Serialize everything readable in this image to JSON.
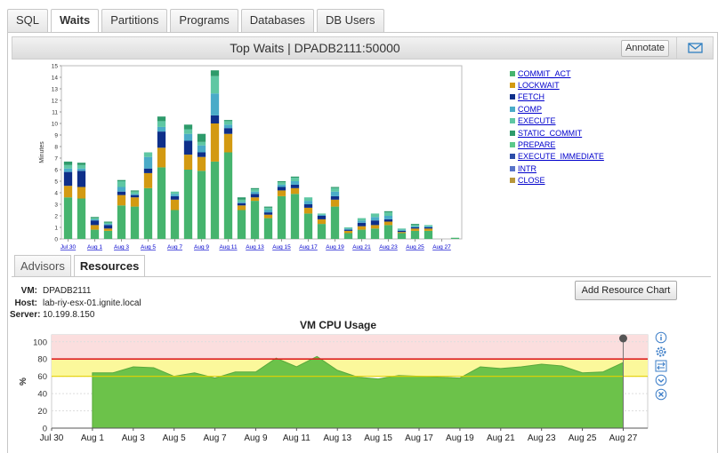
{
  "tabs": [
    "SQL",
    "Waits",
    "Partitions",
    "Programs",
    "Databases",
    "DB Users"
  ],
  "header": {
    "title": "Top Waits  |  DPADB2111:50000",
    "annotate_label": "Annotate",
    "mail_icon": "envelope-icon"
  },
  "legend": [
    "COMMIT_ACT",
    "LOCKWAIT",
    "FETCH",
    "COMP",
    "EXECUTE",
    "STATIC_COMMIT",
    "PREPARE",
    "EXECUTE_IMMEDIATE",
    "INTR",
    "CLOSE"
  ],
  "colors": {
    "COMMIT_ACT": "#46b46e",
    "LOCKWAIT": "#d39a12",
    "FETCH": "#0e2f8a",
    "COMP": "#4aabc8",
    "EXECUTE": "#5fc7a3",
    "STATIC_COMMIT": "#2e9b6b",
    "PREPARE": "#5bc98a",
    "EXECUTE_IMMEDIATE": "#2c4da8",
    "INTR": "#5873c8",
    "CLOSE": "#b8973a"
  },
  "subtabs": [
    "Advisors",
    "Resources"
  ],
  "resources": {
    "vm_key": "VM:",
    "vm": "DPADB2111",
    "host_key": "Host:",
    "host": "lab-riy-esx-01.ignite.local",
    "server_key": "Server:",
    "server": "10.199.8.150",
    "add_button": "Add Resource Chart",
    "side_icons": [
      "info-icon",
      "settings-icon",
      "swap-icon",
      "chevron-down-icon",
      "close-icon"
    ]
  },
  "chart_data": [
    {
      "type": "bar",
      "stacked": true,
      "ylabel": "Minutes",
      "ylim": [
        0,
        15
      ],
      "yticks": [
        0,
        1,
        2,
        3,
        4,
        5,
        6,
        7,
        8,
        9,
        10,
        11,
        12,
        13,
        14,
        15
      ],
      "xtick_labels": [
        "Jul 30",
        "Aug 1",
        "Aug 3",
        "Aug 5",
        "Aug 7",
        "Aug 9",
        "Aug 11",
        "Aug 13",
        "Aug 15",
        "Aug 17",
        "Aug 19",
        "Aug 21",
        "Aug 23",
        "Aug 25",
        "Aug 27"
      ],
      "bars_per_tick": 2,
      "series": [
        {
          "name": "COMMIT_ACT",
          "values": [
            3.6,
            3.5,
            0.8,
            0.7,
            2.9,
            2.8,
            4.4,
            6.2,
            2.5,
            6.0,
            5.9,
            6.7,
            7.5,
            2.5,
            3.3,
            1.8,
            3.7,
            3.9,
            2.2,
            1.3,
            2.8,
            0.5,
            0.8,
            0.9,
            1.2,
            0.5,
            0.7,
            0.7,
            0,
            0.1
          ]
        },
        {
          "name": "LOCKWAIT",
          "values": [
            1.0,
            1.0,
            0.4,
            0.2,
            0.9,
            0.8,
            1.3,
            1.7,
            0.9,
            1.3,
            1.2,
            3.3,
            1.6,
            0.4,
            0.3,
            0.3,
            0.5,
            0.5,
            0.5,
            0.4,
            0.6,
            0.2,
            0.3,
            0.3,
            0.3,
            0.1,
            0.2,
            0.2,
            0,
            0
          ]
        },
        {
          "name": "FETCH",
          "values": [
            1.2,
            1.4,
            0.4,
            0.3,
            0.3,
            0.2,
            0.4,
            1.4,
            0.3,
            1.2,
            0.4,
            0.7,
            0.5,
            0.2,
            0.3,
            0.2,
            0.3,
            0.3,
            0.3,
            0.3,
            0.3,
            0.1,
            0.3,
            0.4,
            0.2,
            0.1,
            0.1,
            0.1,
            0,
            0
          ]
        },
        {
          "name": "COMP",
          "values": [
            0.3,
            0.2,
            0.1,
            0.1,
            0.4,
            0.1,
            1.0,
            0.4,
            0.2,
            0.6,
            0.6,
            1.9,
            0.3,
            0.1,
            0.2,
            0.2,
            0.2,
            0.3,
            0.3,
            0.1,
            0.4,
            0.1,
            0.2,
            0.3,
            0.3,
            0.1,
            0.1,
            0.1,
            0,
            0
          ]
        },
        {
          "name": "EXECUTE",
          "values": [
            0.3,
            0.3,
            0.1,
            0.1,
            0.5,
            0.2,
            0.4,
            0.5,
            0.2,
            0.4,
            0.3,
            1.5,
            0.3,
            0.2,
            0.2,
            0.2,
            0.2,
            0.3,
            0.3,
            0.1,
            0.3,
            0.1,
            0.2,
            0.3,
            0.3,
            0.1,
            0.1,
            0.1,
            0,
            0
          ]
        },
        {
          "name": "STATIC_COMMIT",
          "values": [
            0.3,
            0.2,
            0.1,
            0.1,
            0.1,
            0.1,
            0,
            0.4,
            0,
            0.4,
            0.7,
            0.5,
            0.1,
            0.2,
            0.1,
            0.1,
            0.1,
            0.1,
            0,
            0,
            0.1,
            0,
            0,
            0,
            0.1,
            0,
            0.1,
            0,
            0,
            0
          ]
        }
      ]
    },
    {
      "type": "area",
      "title": "VM CPU Usage",
      "ylabel": "%",
      "ylim": [
        0,
        108
      ],
      "yticks": [
        0,
        20,
        40,
        60,
        80,
        100
      ],
      "xtick_labels": [
        "Jul 30",
        "Aug 1",
        "Aug 3",
        "Aug 5",
        "Aug 7",
        "Aug 9",
        "Aug 11",
        "Aug 13",
        "Aug 15",
        "Aug 17",
        "Aug 19",
        "Aug 21",
        "Aug 23",
        "Aug 25",
        "Aug 27"
      ],
      "x_days": [
        2,
        3,
        4,
        5,
        6,
        7,
        8,
        9,
        10,
        11,
        12,
        13,
        14,
        15,
        16,
        17,
        18,
        19,
        20,
        21,
        22,
        23,
        24,
        25,
        26,
        27,
        28
      ],
      "values": [
        64,
        64,
        71,
        70,
        60,
        64,
        58,
        65,
        65,
        81,
        71,
        83,
        67,
        59,
        57,
        61,
        60,
        59,
        58,
        71,
        69,
        71,
        74,
        72,
        64,
        65,
        76
      ],
      "thresholds": {
        "warning": 60,
        "critical": 80
      },
      "end_marker_day": 28
    }
  ]
}
